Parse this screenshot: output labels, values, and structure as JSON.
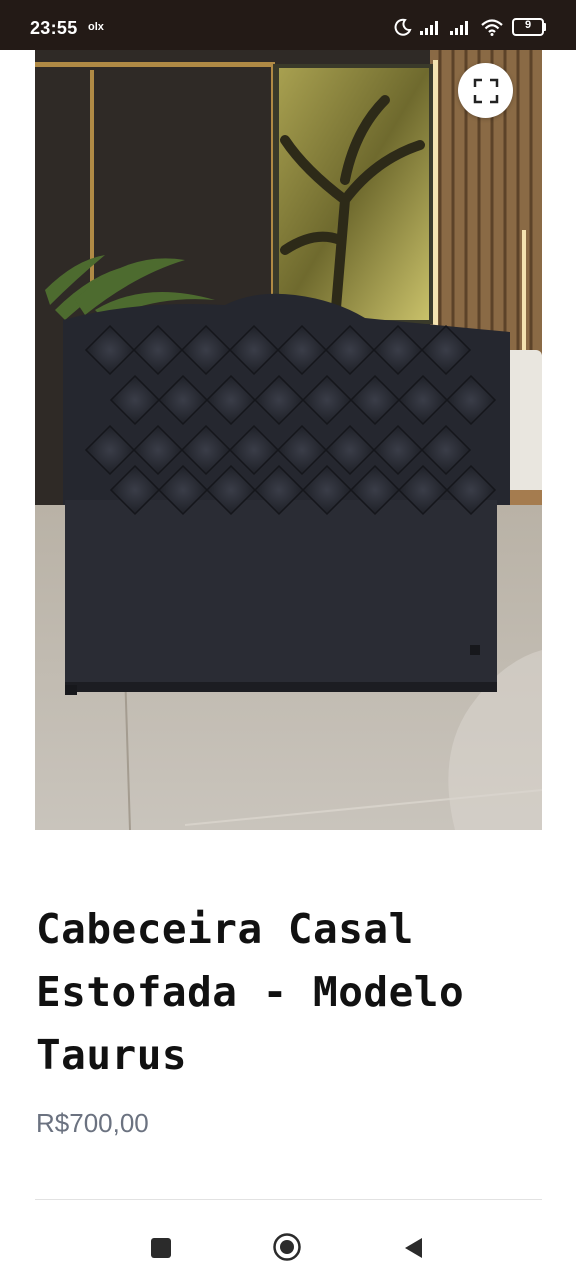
{
  "status_bar": {
    "time": "23:55",
    "app_indicator": "olx",
    "battery_level": "9",
    "icons": [
      "moon-icon",
      "signal-icon",
      "signal-icon",
      "wifi-icon",
      "battery-icon"
    ]
  },
  "gallery": {
    "image_alt": "Tufted dark upholstered headboard in a showroom",
    "fullscreen_icon": "expand-icon"
  },
  "product": {
    "title": "Cabeceira Casal Estofada - Modelo Taurus",
    "price": "R$700,00"
  },
  "nav": {
    "icons": [
      "recent-apps-icon",
      "home-icon",
      "back-icon"
    ]
  },
  "colors": {
    "status_bar_bg": "#231a16",
    "title_color": "#111111",
    "price_color": "#6b7280"
  }
}
